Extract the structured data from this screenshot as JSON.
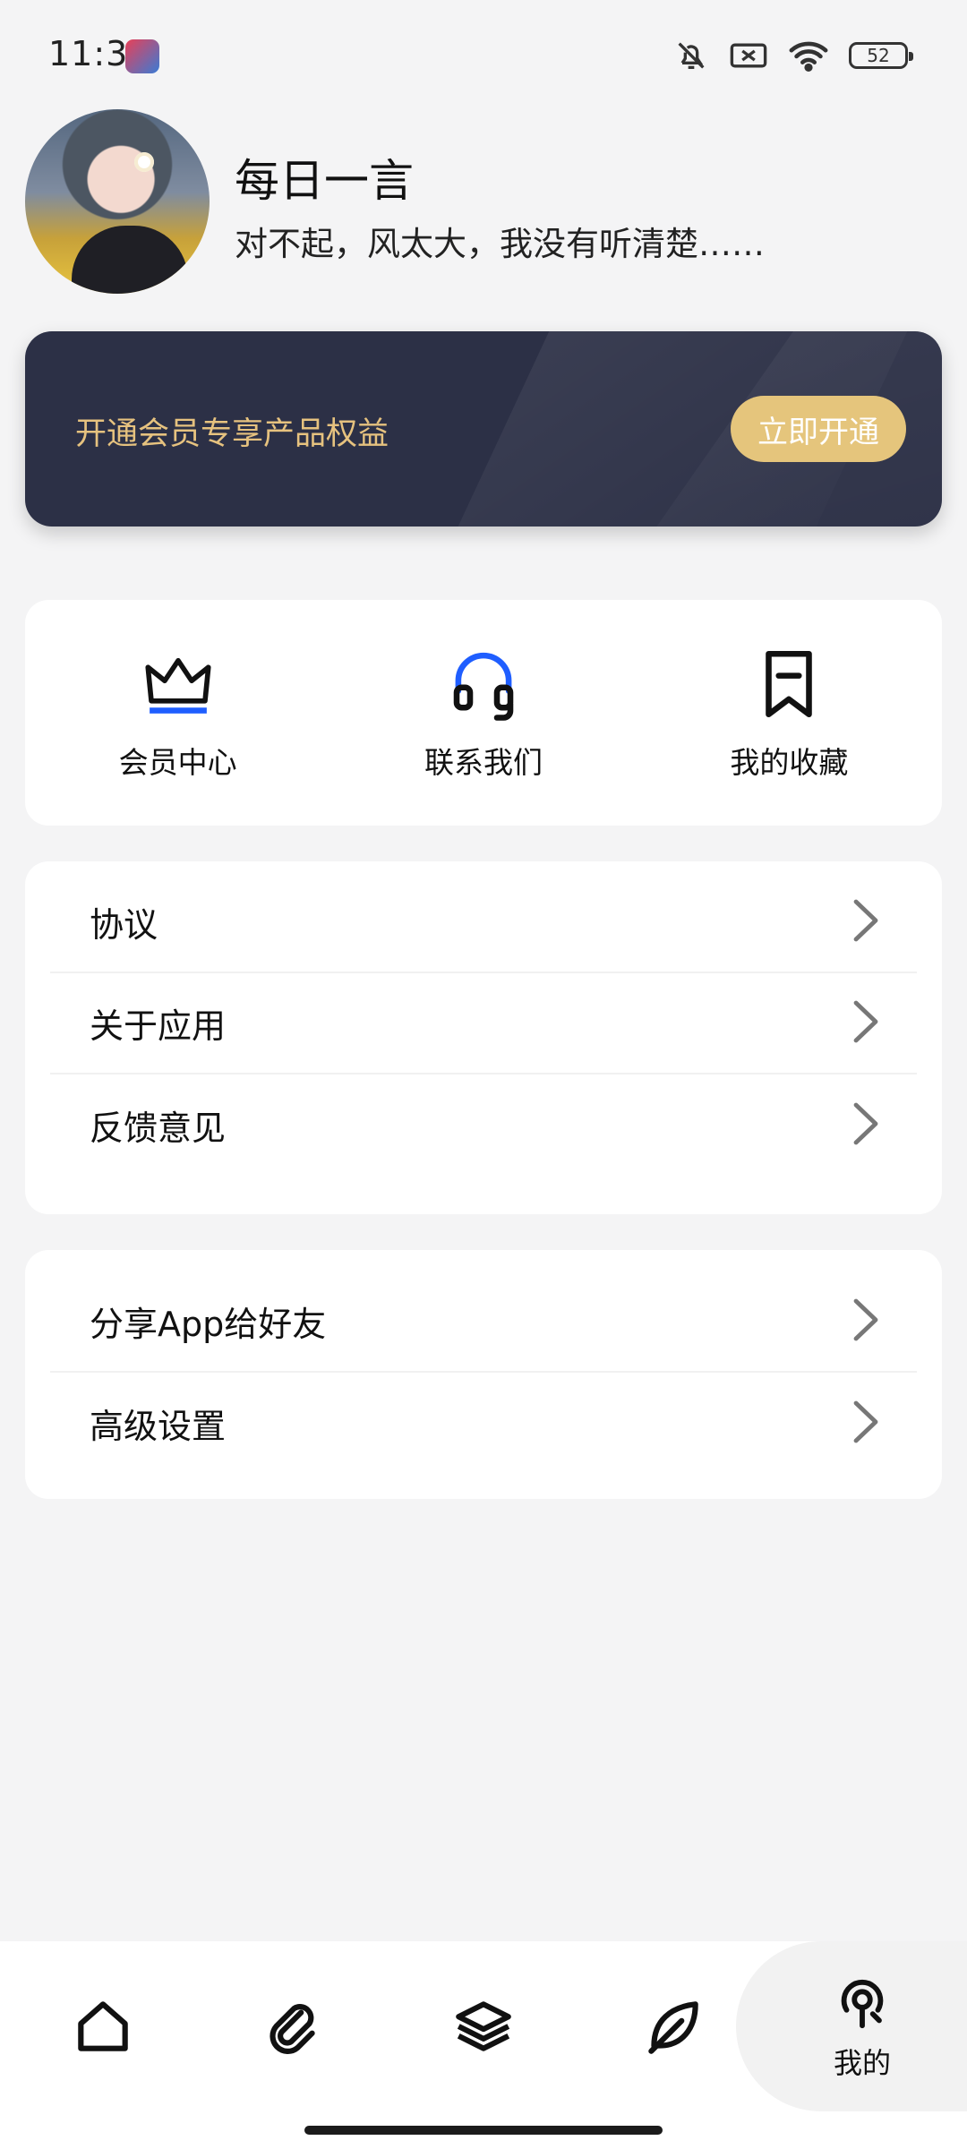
{
  "status_bar": {
    "time": "11:31",
    "battery": "52",
    "icons": [
      "bell-off-icon",
      "no-sim-icon",
      "wifi-icon",
      "battery-icon"
    ]
  },
  "profile": {
    "title": "每日一言",
    "quote": "对不起，风太大，我没有听清楚……"
  },
  "vip": {
    "text": "开通会员专享产品权益",
    "button": "立即开通",
    "text_color": "#e6c27f",
    "button_color": "#e5c57c",
    "background": "#2c3046"
  },
  "quick_actions": [
    {
      "label": "会员中心",
      "icon": "crown-icon"
    },
    {
      "label": "联系我们",
      "icon": "headset-icon"
    },
    {
      "label": "我的收藏",
      "icon": "bookmark-icon"
    }
  ],
  "menu_group_1": [
    {
      "label": "协议"
    },
    {
      "label": "关于应用"
    },
    {
      "label": "反馈意见"
    }
  ],
  "menu_group_2": [
    {
      "label": "分享App给好友"
    },
    {
      "label": "高级设置"
    }
  ],
  "bottom_nav": {
    "items": [
      "home-icon",
      "paperclip-icon",
      "layers-icon",
      "leaf-icon",
      "profile-icon"
    ],
    "active_label": "我的"
  },
  "accent": "#1f5eff"
}
